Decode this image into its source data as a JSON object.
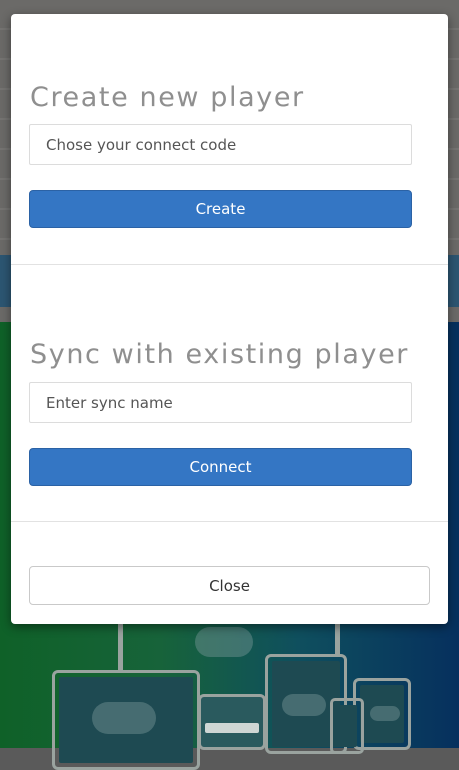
{
  "create_section": {
    "title": "Create new player",
    "input_placeholder": "Chose your connect code",
    "button_label": "Create"
  },
  "sync_section": {
    "title": "Sync with existing player",
    "input_placeholder": "Enter sync name",
    "button_label": "Connect"
  },
  "footer": {
    "close_label": "Close"
  },
  "colors": {
    "primary_button": "#3476c4",
    "title_text": "#8f8f8f"
  }
}
